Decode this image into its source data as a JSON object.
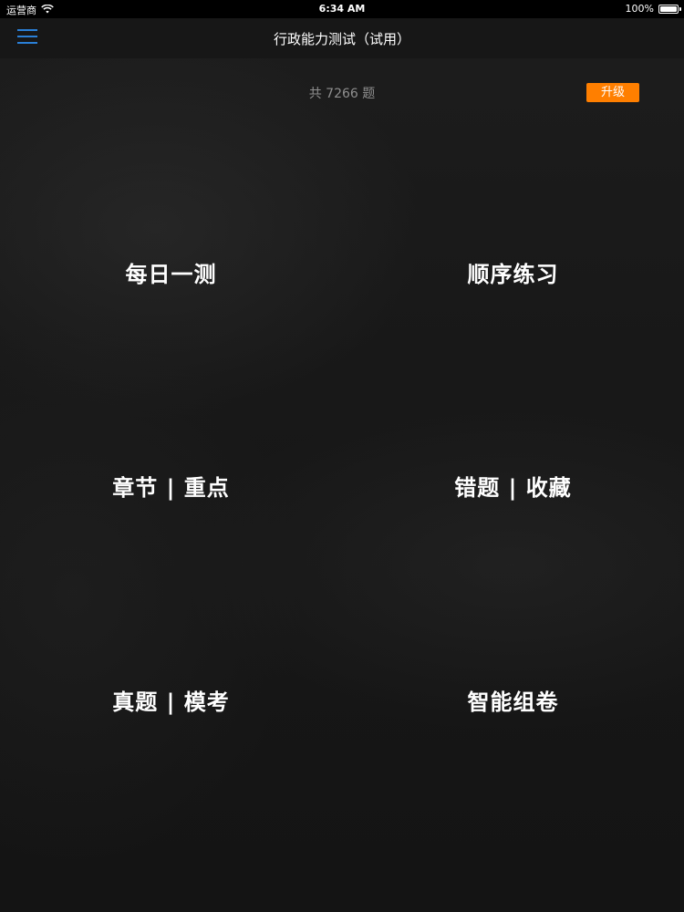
{
  "status_bar": {
    "carrier": "运营商",
    "time": "6:34 AM",
    "battery": "100%",
    "battery_level": 1.0
  },
  "nav": {
    "title": "行政能力测试（试用）",
    "menu_icon": "hamburger-menu-icon",
    "accent_color": "#2a7fd6"
  },
  "summary": {
    "question_count": "共 7266 题",
    "upgrade_label": "升级",
    "upgrade_color": "#ff7f00"
  },
  "menu": {
    "items": [
      {
        "label": "每日一测"
      },
      {
        "label": "顺序练习"
      },
      {
        "label": "章节 | 重点"
      },
      {
        "label": "错题 | 收藏"
      },
      {
        "label": "真题 | 模考"
      },
      {
        "label": "智能组卷"
      }
    ]
  }
}
